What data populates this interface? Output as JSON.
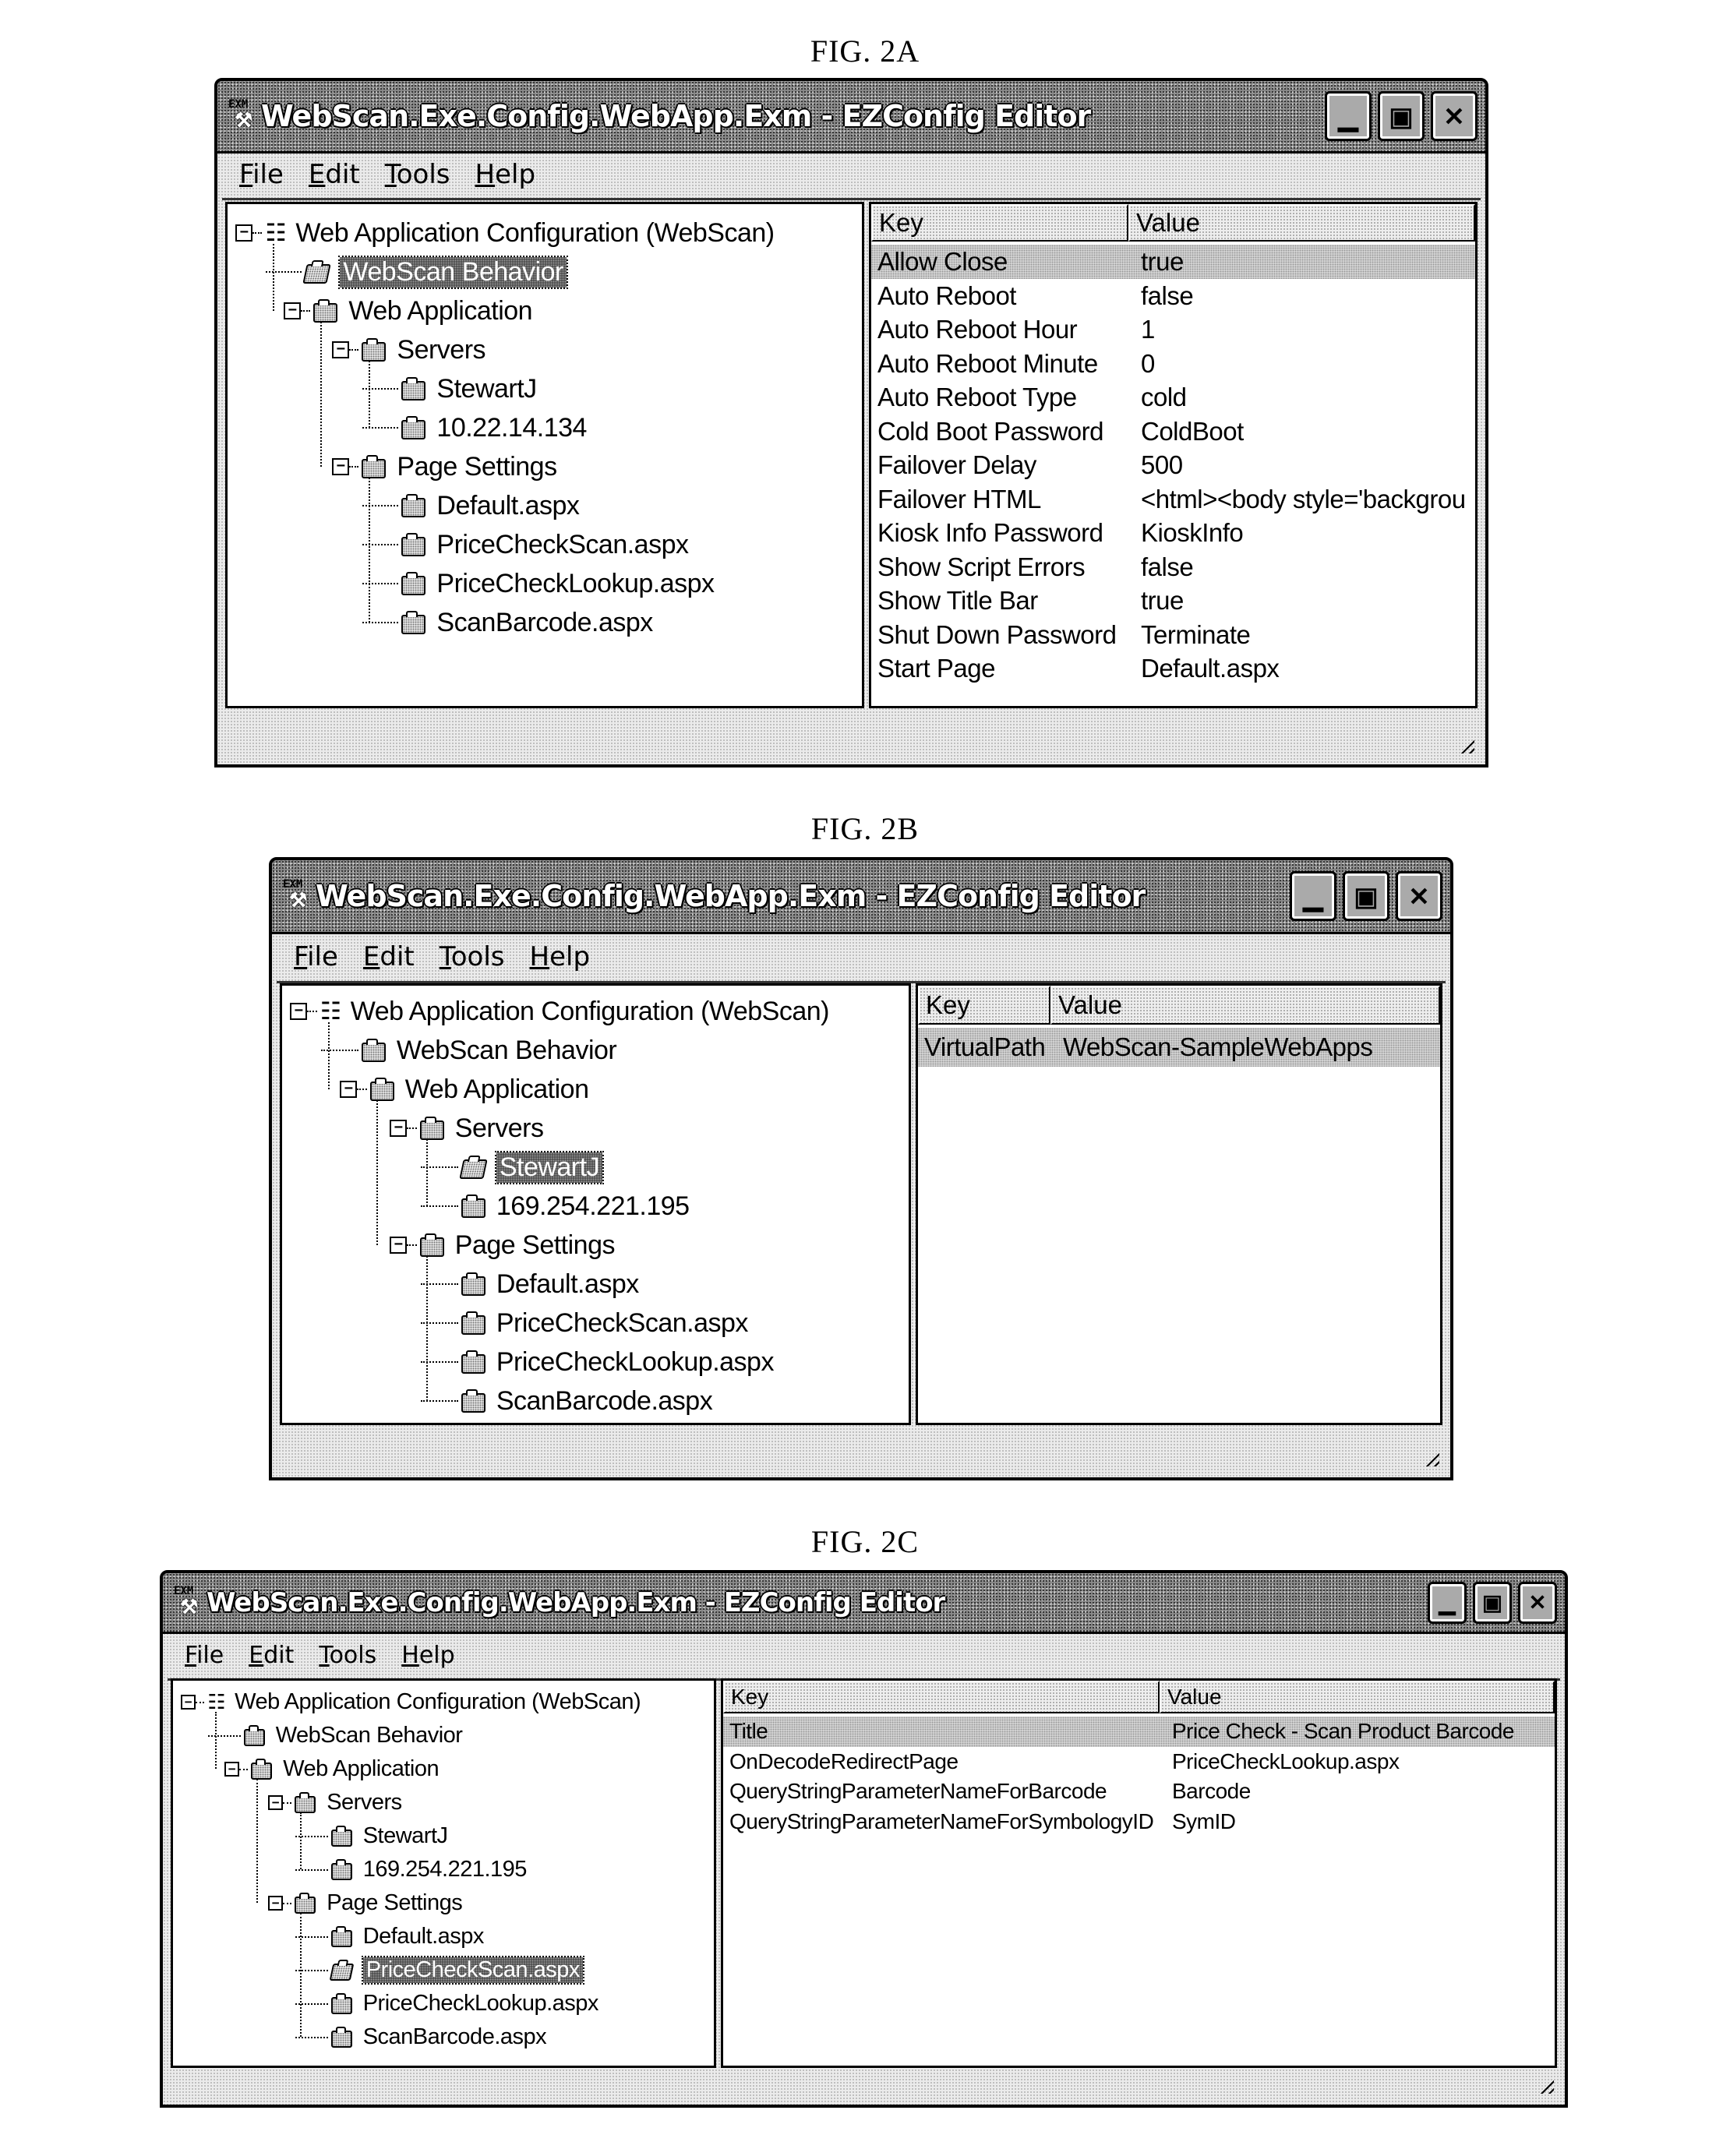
{
  "figures": [
    {
      "label": "FIG. 2A",
      "window": {
        "title": "WebScan.Exe.Config.WebApp.Exm - EZConfig Editor",
        "app_icon": "exm-config-icon",
        "buttons": [
          "minimize",
          "maximize",
          "close"
        ]
      },
      "menu": [
        {
          "label": "File",
          "mnemonic": "F"
        },
        {
          "label": "Edit",
          "mnemonic": "E"
        },
        {
          "label": "Tools",
          "mnemonic": "T"
        },
        {
          "label": "Help",
          "mnemonic": "H"
        }
      ],
      "tree": [
        {
          "label": "Web Application Configuration (WebScan)",
          "level": 0,
          "icon": "network-icon",
          "expanded": true
        },
        {
          "label": "WebScan Behavior",
          "level": 1,
          "icon": "folder-open-icon",
          "selected": true
        },
        {
          "label": "Web Application",
          "level": 1,
          "icon": "folder-icon",
          "expanded": true
        },
        {
          "label": "Servers",
          "level": 2,
          "icon": "folder-icon",
          "expanded": true
        },
        {
          "label": "StewartJ",
          "level": 3,
          "icon": "folder-icon"
        },
        {
          "label": "10.22.14.134",
          "level": 3,
          "icon": "folder-icon"
        },
        {
          "label": "Page Settings",
          "level": 2,
          "icon": "folder-icon",
          "expanded": true
        },
        {
          "label": "Default.aspx",
          "level": 3,
          "icon": "folder-icon"
        },
        {
          "label": "PriceCheckScan.aspx",
          "level": 3,
          "icon": "folder-icon"
        },
        {
          "label": "PriceCheckLookup.aspx",
          "level": 3,
          "icon": "folder-icon"
        },
        {
          "label": "ScanBarcode.aspx",
          "level": 3,
          "icon": "folder-icon"
        }
      ],
      "list": {
        "columns": [
          "Key",
          "Value"
        ],
        "rows": [
          {
            "key": "Allow Close",
            "value": "true"
          },
          {
            "key": "Auto Reboot",
            "value": "false"
          },
          {
            "key": "Auto Reboot Hour",
            "value": "1"
          },
          {
            "key": "Auto Reboot Minute",
            "value": "0"
          },
          {
            "key": "Auto Reboot Type",
            "value": "cold"
          },
          {
            "key": "Cold Boot Password",
            "value": "ColdBoot"
          },
          {
            "key": "Failover Delay",
            "value": "500"
          },
          {
            "key": "Failover HTML",
            "value": "<html><body style='backgrou"
          },
          {
            "key": "Kiosk Info Password",
            "value": "KioskInfo"
          },
          {
            "key": "Show Script Errors",
            "value": "false"
          },
          {
            "key": "Show Title Bar",
            "value": "true"
          },
          {
            "key": "Shut Down Password",
            "value": "Terminate"
          },
          {
            "key": "Start Page",
            "value": "Default.aspx"
          }
        ]
      }
    },
    {
      "label": "FIG. 2B",
      "window": {
        "title": "WebScan.Exe.Config.WebApp.Exm - EZConfig Editor",
        "app_icon": "exm-config-icon",
        "buttons": [
          "minimize",
          "maximize",
          "close"
        ]
      },
      "menu": [
        {
          "label": "File",
          "mnemonic": "F"
        },
        {
          "label": "Edit",
          "mnemonic": "E"
        },
        {
          "label": "Tools",
          "mnemonic": "T"
        },
        {
          "label": "Help",
          "mnemonic": "H"
        }
      ],
      "tree": [
        {
          "label": "Web Application Configuration (WebScan)",
          "level": 0,
          "icon": "network-icon",
          "expanded": true
        },
        {
          "label": "WebScan Behavior",
          "level": 1,
          "icon": "folder-icon"
        },
        {
          "label": "Web Application",
          "level": 1,
          "icon": "folder-icon",
          "expanded": true
        },
        {
          "label": "Servers",
          "level": 2,
          "icon": "folder-icon",
          "expanded": true
        },
        {
          "label": "StewartJ",
          "level": 3,
          "icon": "folder-open-icon",
          "selected": true
        },
        {
          "label": "169.254.221.195",
          "level": 3,
          "icon": "folder-icon"
        },
        {
          "label": "Page Settings",
          "level": 2,
          "icon": "folder-icon",
          "expanded": true
        },
        {
          "label": "Default.aspx",
          "level": 3,
          "icon": "folder-icon"
        },
        {
          "label": "PriceCheckScan.aspx",
          "level": 3,
          "icon": "folder-icon"
        },
        {
          "label": "PriceCheckLookup.aspx",
          "level": 3,
          "icon": "folder-icon"
        },
        {
          "label": "ScanBarcode.aspx",
          "level": 3,
          "icon": "folder-icon"
        }
      ],
      "list": {
        "columns": [
          "Key",
          "Value"
        ],
        "rows": [
          {
            "key": "VirtualPath",
            "value": "WebScan-SampleWebApps"
          }
        ]
      }
    },
    {
      "label": "FIG. 2C",
      "window": {
        "title": "WebScan.Exe.Config.WebApp.Exm - EZConfig Editor",
        "app_icon": "exm-config-icon",
        "buttons": [
          "minimize",
          "maximize",
          "close"
        ]
      },
      "menu": [
        {
          "label": "File",
          "mnemonic": "F"
        },
        {
          "label": "Edit",
          "mnemonic": "E"
        },
        {
          "label": "Tools",
          "mnemonic": "T"
        },
        {
          "label": "Help",
          "mnemonic": "H"
        }
      ],
      "tree": [
        {
          "label": "Web Application Configuration (WebScan)",
          "level": 0,
          "icon": "network-icon",
          "expanded": true
        },
        {
          "label": "WebScan Behavior",
          "level": 1,
          "icon": "folder-icon"
        },
        {
          "label": "Web Application",
          "level": 1,
          "icon": "folder-icon",
          "expanded": true
        },
        {
          "label": "Servers",
          "level": 2,
          "icon": "folder-icon",
          "expanded": true
        },
        {
          "label": "StewartJ",
          "level": 3,
          "icon": "folder-icon"
        },
        {
          "label": "169.254.221.195",
          "level": 3,
          "icon": "folder-icon"
        },
        {
          "label": "Page Settings",
          "level": 2,
          "icon": "folder-icon",
          "expanded": true
        },
        {
          "label": "Default.aspx",
          "level": 3,
          "icon": "folder-icon"
        },
        {
          "label": "PriceCheckScan.aspx",
          "level": 3,
          "icon": "folder-open-icon",
          "selected": true
        },
        {
          "label": "PriceCheckLookup.aspx",
          "level": 3,
          "icon": "folder-icon"
        },
        {
          "label": "ScanBarcode.aspx",
          "level": 3,
          "icon": "folder-icon"
        }
      ],
      "list": {
        "columns": [
          "Key",
          "Value"
        ],
        "rows": [
          {
            "key": "Title",
            "value": "Price Check - Scan Product Barcode"
          },
          {
            "key": "OnDecodeRedirectPage",
            "value": "PriceCheckLookup.aspx"
          },
          {
            "key": "QueryStringParameterNameForBarcode",
            "value": "Barcode"
          },
          {
            "key": "QueryStringParameterNameForSymbologyID",
            "value": "SymID"
          }
        ]
      }
    }
  ]
}
